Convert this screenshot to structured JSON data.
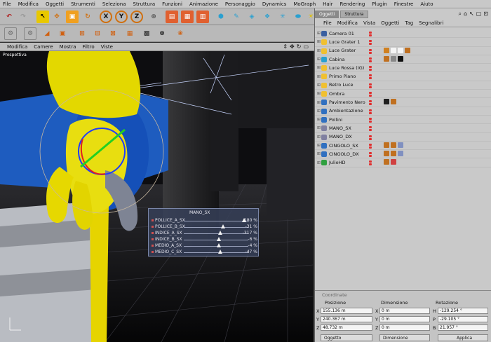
{
  "menubar": {
    "items": [
      "File",
      "Modifica",
      "Oggetti",
      "Strumenti",
      "Seleziona",
      "Struttura",
      "Funzioni",
      "Animazione",
      "Personaggio",
      "Dynamics",
      "MoGraph",
      "Hair",
      "Rendering",
      "Plugin",
      "Finestre",
      "Aiuto"
    ]
  },
  "toolbar": {
    "axis_labels": {
      "x": "X",
      "y": "Y",
      "z": "Z"
    }
  },
  "viewport": {
    "menu": [
      "Modifica",
      "Camere",
      "Mostra",
      "Filtro",
      "Viste"
    ],
    "label": "Prospettiva",
    "nav": [
      "⇕",
      "✥",
      "↻",
      "▭"
    ]
  },
  "pose_panel": {
    "title": "MANO_SX",
    "rows": [
      {
        "name": "POLLICE_A_SX",
        "value": "180 %",
        "level": 0.96
      },
      {
        "name": "POLLICE_B_SX",
        "value": "-31 %",
        "level": 0.62
      },
      {
        "name": "INDICE_A_SX",
        "value": "-317 %",
        "level": 0.58
      },
      {
        "name": "INDICE_B_SX",
        "value": "-6 %",
        "level": 0.55
      },
      {
        "name": "MEDIO_A_SX",
        "value": "-4 %",
        "level": 0.55
      },
      {
        "name": "MEDIO_C_SX",
        "value": "-47 %",
        "level": 0.58
      }
    ]
  },
  "objects_panel": {
    "tabs": [
      "Oggetti",
      "Struttura"
    ],
    "menu": [
      "File",
      "Modifica",
      "Vista",
      "Oggetti",
      "Tag",
      "Segnalibri"
    ],
    "tools": [
      "⌕",
      "⌂",
      "↖",
      "▢",
      "⊡"
    ],
    "items": [
      {
        "name": "Camera 01",
        "icon_color": "#3a5fa0",
        "tags": []
      },
      {
        "name": "Luce Grater 1",
        "icon_color": "#f0c030",
        "tags": []
      },
      {
        "name": "Luce Grater",
        "icon_color": "#f0c030",
        "tags": [
          "#d08020",
          "#f4f4f4",
          "#f4f4f4",
          "#c07020"
        ]
      },
      {
        "name": "Cabina",
        "icon_color": "#29a0d0",
        "tags": [
          "#c07020",
          "#888888",
          "#101010"
        ]
      },
      {
        "name": "Luce Rossa (IG)",
        "icon_color": "#f0c030",
        "tags": []
      },
      {
        "name": "Primo Piano",
        "icon_color": "#f0c030",
        "tags": []
      },
      {
        "name": "Retro Luce",
        "icon_color": "#f0c030",
        "tags": []
      },
      {
        "name": "Ombra",
        "icon_color": "#f0c030",
        "tags": []
      },
      {
        "name": "Pavimento Nero",
        "icon_color": "#3070c0",
        "tags": [
          "#202020",
          "#c07020"
        ]
      },
      {
        "name": "Ambientazione",
        "icon_color": "#3070c0",
        "tags": []
      },
      {
        "name": "Pollini",
        "icon_color": "#3070c0",
        "tags": []
      },
      {
        "name": "MANO_SX",
        "icon_color": "#8080a0",
        "tags": []
      },
      {
        "name": "MANO_DX",
        "icon_color": "#8080a0",
        "tags": []
      },
      {
        "name": "CINGOLO_SX",
        "icon_color": "#3070c0",
        "tags": [
          "#c07020",
          "#c07020",
          "#8090c0"
        ]
      },
      {
        "name": "CINGOLO_DX",
        "icon_color": "#3070c0",
        "tags": [
          "#c07020",
          "#c07020",
          "#8090c0"
        ]
      },
      {
        "name": "JulioHD",
        "icon_color": "#30a040",
        "tags": [
          "#c07020",
          "#d04040"
        ]
      }
    ]
  },
  "coordinates": {
    "title": "Coordinate",
    "headers": [
      "Posizione",
      "Dimensione",
      "Rotazione"
    ],
    "rows": [
      {
        "axis": "X",
        "pos": "155.136 m",
        "dim": "0 m",
        "rot_label": "H",
        "rot": "-129.254 °"
      },
      {
        "axis": "Y",
        "pos": "240.367 m",
        "dim": "0 m",
        "rot_label": "P",
        "rot": "-29.105 °"
      },
      {
        "axis": "Z",
        "pos": "48.732 m",
        "dim": "0 m",
        "rot_label": "B",
        "rot": "21.957 °"
      }
    ],
    "mode": "Oggetto",
    "dim_mode": "Dimensione",
    "apply": "Applica"
  },
  "colors": {
    "accent": "#e8c800",
    "panel_bg": "#c9c9c9",
    "viewport_bg": "#101012"
  }
}
